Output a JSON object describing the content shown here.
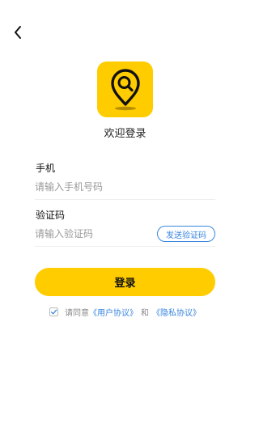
{
  "colors": {
    "brand": "#FFCC00",
    "link": "#3A86E0"
  },
  "header": {
    "back_icon": "chevron-left-icon"
  },
  "logo": {
    "icon": "map-pin-search-icon"
  },
  "welcome_title": "欢迎登录",
  "phone": {
    "label": "手机",
    "placeholder": "请输入手机号码",
    "value": ""
  },
  "code": {
    "label": "验证码",
    "placeholder": "请输入验证码",
    "value": "",
    "send_label": "发送验证码"
  },
  "login_button": "登录",
  "agreement": {
    "checked": true,
    "prefix": "请同意",
    "user_agreement": "《用户协议》",
    "conjunction": "和",
    "privacy_policy": "《隐私协议》"
  }
}
